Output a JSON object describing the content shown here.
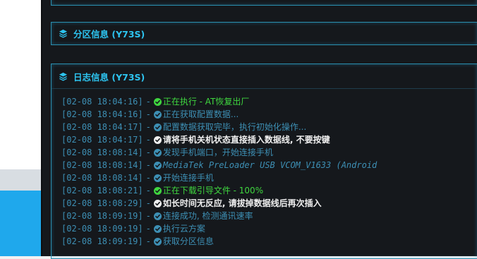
{
  "colors": {
    "accent": "#2dc4f0",
    "log_blue": "#3d8fb4",
    "log_green": "#3fd63f",
    "log_white": "#f0f0f0"
  },
  "panels": {
    "partition_title": "分区信息 (Y73S)",
    "log_title": "日志信息 (Y73S)"
  },
  "log": [
    {
      "time": "[02-08 18:04:16]",
      "sep": "-",
      "text": "正在执行 - AT恢复出厂",
      "color": "#3fd63f",
      "bold": false,
      "icon": "check-circle-icon"
    },
    {
      "time": "[02-08 18:04:16]",
      "sep": "-",
      "text": "正在获取配置数据...",
      "color": "#3d8fb4",
      "bold": false,
      "icon": "check-circle-icon"
    },
    {
      "time": "[02-08 18:04:17]",
      "sep": "-",
      "text": "配置数据获取完毕，执行初始化操作...",
      "color": "#3d8fb4",
      "bold": false,
      "icon": "check-circle-icon"
    },
    {
      "time": "[02-08 18:04:17]",
      "sep": "-",
      "text": "请将手机关机状态直接插入数据线, 不要按键",
      "color": "#f0f0f0",
      "bold": true,
      "icon": "check-circle-icon"
    },
    {
      "time": "[02-08 18:08:14]",
      "sep": "-",
      "text": "发现手机端口，开始连接手机",
      "color": "#3d8fb4",
      "bold": false,
      "icon": "check-circle-icon"
    },
    {
      "time": "[02-08 18:08:14]",
      "sep": "-",
      "text": "MediaTek PreLoader USB VCOM_V1633 (Android",
      "color": "#3d8fb4",
      "bold": false,
      "icon": "check-circle-icon",
      "mono": true
    },
    {
      "time": "[02-08 18:08:14]",
      "sep": "-",
      "text": "开始连接手机",
      "color": "#3d8fb4",
      "bold": false,
      "icon": "check-circle-icon"
    },
    {
      "time": "[02-08 18:08:21]",
      "sep": "-",
      "text": "正在下载引导文件 - 100%",
      "color": "#3fd63f",
      "bold": false,
      "icon": "check-circle-icon"
    },
    {
      "time": "[02-08 18:08:29]",
      "sep": "-",
      "text": "如长时间无反应, 请拔掉数据线后再次插入",
      "color": "#f0f0f0",
      "bold": true,
      "icon": "check-circle-icon"
    },
    {
      "time": "[02-08 18:09:19]",
      "sep": "-",
      "text": "连接成功, 检测通讯速率",
      "color": "#3d8fb4",
      "bold": false,
      "icon": "check-circle-icon"
    },
    {
      "time": "[02-08 18:09:19]",
      "sep": "-",
      "text": "执行云方案",
      "color": "#3d8fb4",
      "bold": false,
      "icon": "check-circle-icon"
    },
    {
      "time": "[02-08 18:09:19]",
      "sep": "-",
      "text": "获取分区信息",
      "color": "#3d8fb4",
      "bold": false,
      "icon": "check-circle-icon"
    }
  ]
}
